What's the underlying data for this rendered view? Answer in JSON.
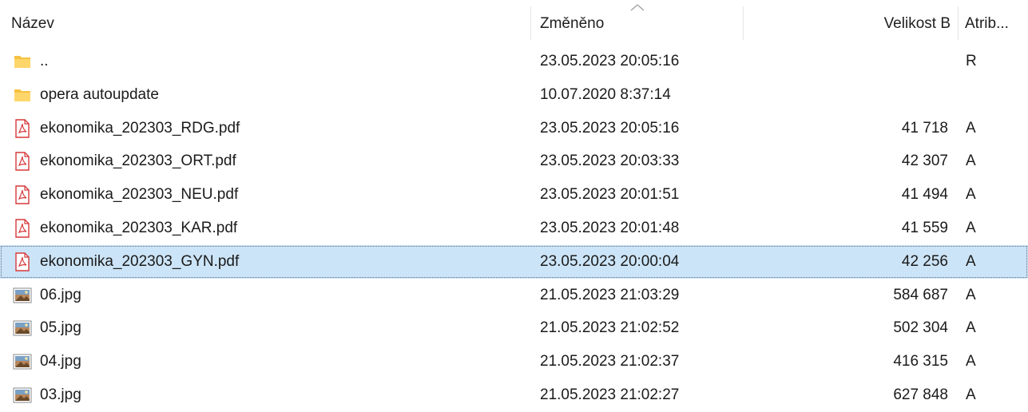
{
  "columns": {
    "name": "Název",
    "modified": "Změněno",
    "size": "Velikost B",
    "attributes": "Atrib..."
  },
  "files": [
    {
      "icon": "parent-folder-icon",
      "name": "..",
      "modified": "23.05.2023 20:05:16",
      "size": "",
      "attr": "R"
    },
    {
      "icon": "folder-icon",
      "name": "opera autoupdate",
      "modified": "10.07.2020 8:37:14",
      "size": "",
      "attr": ""
    },
    {
      "icon": "pdf-file-icon",
      "name": "ekonomika_202303_RDG.pdf",
      "modified": "23.05.2023 20:05:16",
      "size": "41 718",
      "attr": "A"
    },
    {
      "icon": "pdf-file-icon",
      "name": "ekonomika_202303_ORT.pdf",
      "modified": "23.05.2023 20:03:33",
      "size": "42 307",
      "attr": "A"
    },
    {
      "icon": "pdf-file-icon",
      "name": "ekonomika_202303_NEU.pdf",
      "modified": "23.05.2023 20:01:51",
      "size": "41 494",
      "attr": "A"
    },
    {
      "icon": "pdf-file-icon",
      "name": "ekonomika_202303_KAR.pdf",
      "modified": "23.05.2023 20:01:48",
      "size": "41 559",
      "attr": "A"
    },
    {
      "icon": "pdf-file-icon",
      "name": "ekonomika_202303_GYN.pdf",
      "modified": "23.05.2023 20:00:04",
      "size": "42 256",
      "attr": "A",
      "selected": true
    },
    {
      "icon": "image-file-icon",
      "name": "06.jpg",
      "modified": "21.05.2023 21:03:29",
      "size": "584 687",
      "attr": "A"
    },
    {
      "icon": "image-file-icon",
      "name": "05.jpg",
      "modified": "21.05.2023 21:02:52",
      "size": "502 304",
      "attr": "A"
    },
    {
      "icon": "image-file-icon",
      "name": "04.jpg",
      "modified": "21.05.2023 21:02:37",
      "size": "416 315",
      "attr": "A"
    },
    {
      "icon": "image-file-icon",
      "name": "03.jpg",
      "modified": "21.05.2023 21:02:27",
      "size": "627 848",
      "attr": "A"
    }
  ],
  "colors": {
    "selection": "#cce4f7",
    "folder": "#f5c241",
    "pdf": "#d6383a"
  }
}
